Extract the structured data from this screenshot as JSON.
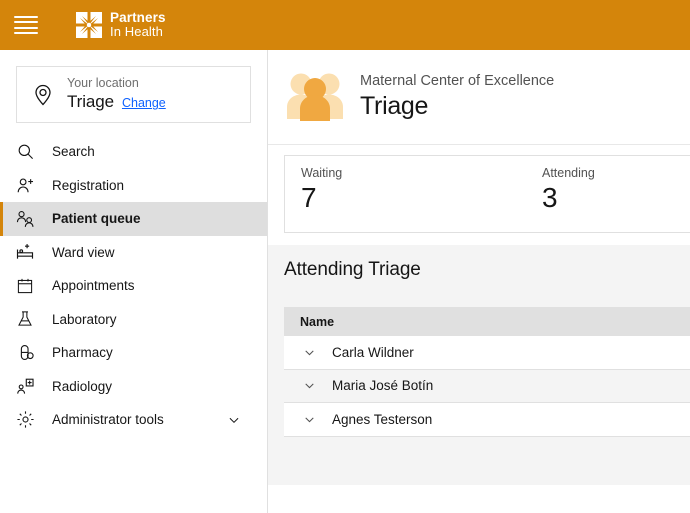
{
  "colors": {
    "brand_orange": "#D4850B",
    "active_bg": "#dedede",
    "link_blue": "#0f62fe",
    "panel_grey": "#f4f4f4",
    "table_header_grey": "#e0e0e0",
    "people_icon_front": "#F0A841",
    "people_icon_back": "#FBDFB0"
  },
  "topbar": {
    "menu_icon": "hamburger-menu-icon",
    "logo_mark": "partners-in-health-logo-mark",
    "logo_line1": "Partners",
    "logo_line2": "In Health"
  },
  "sidebar": {
    "location_card": {
      "icon": "location-pin-icon",
      "label": "Your location",
      "value": "Triage",
      "change_link": "Change"
    },
    "items": [
      {
        "label": "Search",
        "icon": "search-icon",
        "active": false,
        "expandable": false
      },
      {
        "label": "Registration",
        "icon": "user-add-icon",
        "active": false,
        "expandable": false
      },
      {
        "label": "Patient queue",
        "icon": "users-icon",
        "active": true,
        "expandable": false
      },
      {
        "label": "Ward view",
        "icon": "bed-add-icon",
        "active": false,
        "expandable": false
      },
      {
        "label": "Appointments",
        "icon": "calendar-icon",
        "active": false,
        "expandable": false
      },
      {
        "label": "Laboratory",
        "icon": "flask-icon",
        "active": false,
        "expandable": false
      },
      {
        "label": "Pharmacy",
        "icon": "pill-icon",
        "active": false,
        "expandable": false
      },
      {
        "label": "Radiology",
        "icon": "xray-person-icon",
        "active": false,
        "expandable": false
      },
      {
        "label": "Administrator tools",
        "icon": "gear-icon",
        "active": false,
        "expandable": true
      }
    ]
  },
  "main": {
    "header": {
      "icon": "group-of-people-icon",
      "subtitle": "Maternal Center of Excellence",
      "title": "Triage"
    },
    "stats": [
      {
        "label": "Waiting",
        "value": "7"
      },
      {
        "label": "Attending",
        "value": "3"
      }
    ],
    "queue": {
      "title": "Attending Triage",
      "columns": [
        "Name"
      ],
      "rows": [
        {
          "name": "Carla Wildner",
          "expand_icon": "chevron-down-icon"
        },
        {
          "name": "Maria José Botín",
          "expand_icon": "chevron-down-icon"
        },
        {
          "name": "Agnes Testerson",
          "expand_icon": "chevron-down-icon"
        }
      ]
    }
  }
}
